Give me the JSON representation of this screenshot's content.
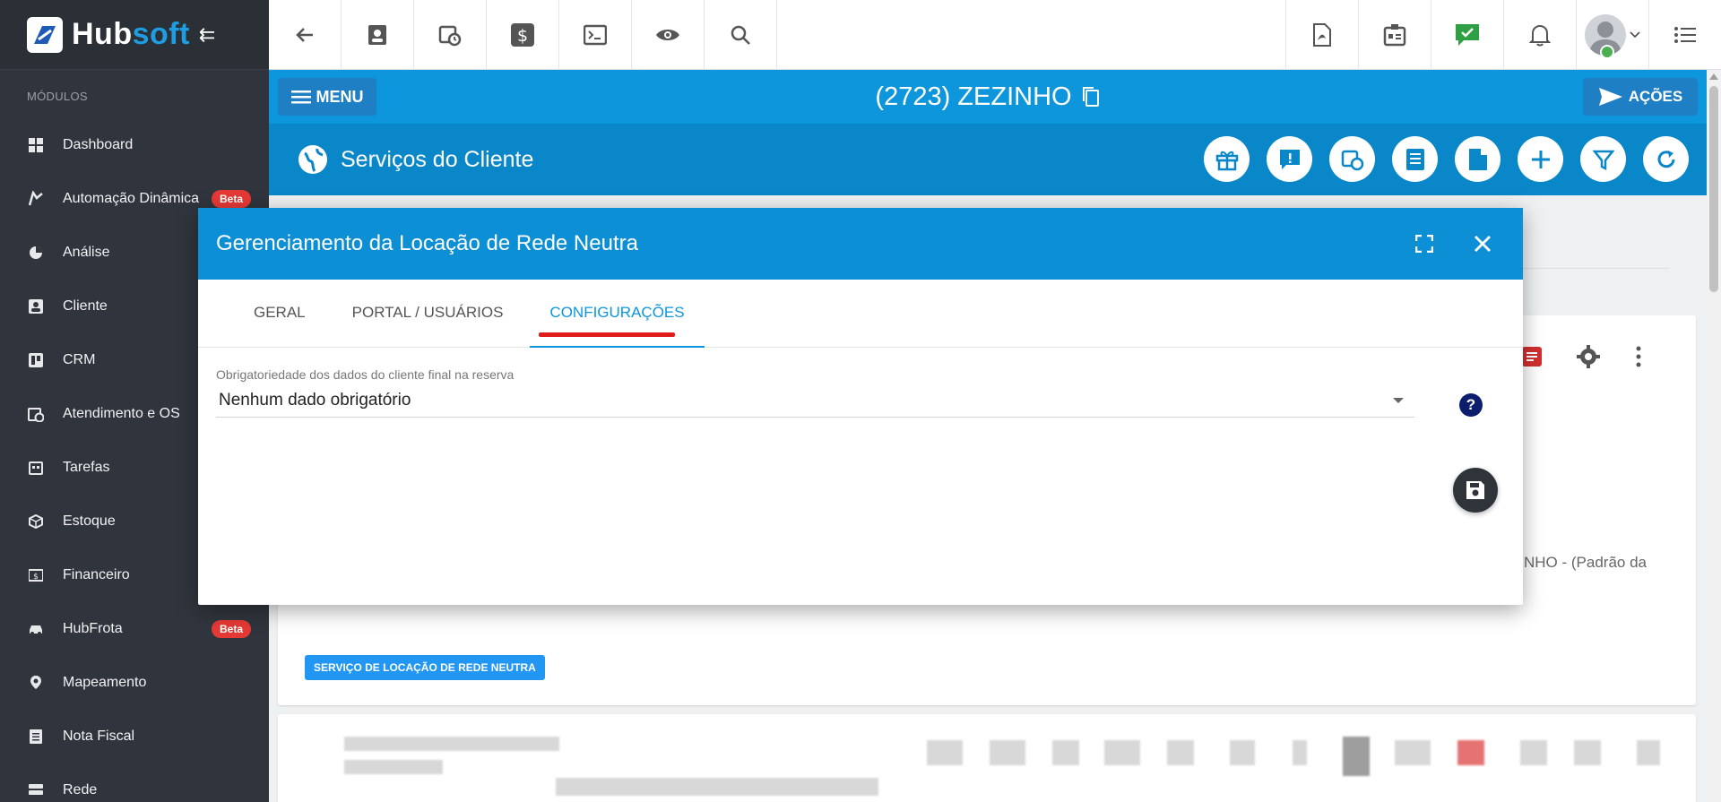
{
  "brand": {
    "hub": "Hub",
    "soft": "soft"
  },
  "sidebar": {
    "section_title": "MÓDULOS",
    "items": [
      {
        "label": "Dashboard",
        "icon": "dashboard-icon"
      },
      {
        "label": "Automação Dinâmica",
        "icon": "automation-icon",
        "badge": "Beta"
      },
      {
        "label": "Análise",
        "icon": "pie-chart-icon"
      },
      {
        "label": "Cliente",
        "icon": "contact-card-icon"
      },
      {
        "label": "CRM",
        "icon": "crm-board-icon"
      },
      {
        "label": "Atendimento e OS",
        "icon": "calendar-clock-icon"
      },
      {
        "label": "Tarefas",
        "icon": "tasks-icon"
      },
      {
        "label": "Estoque",
        "icon": "box-icon"
      },
      {
        "label": "Financeiro",
        "icon": "money-icon"
      },
      {
        "label": "HubFrota",
        "icon": "car-icon",
        "badge": "Beta"
      },
      {
        "label": "Mapeamento",
        "icon": "map-pin-icon"
      },
      {
        "label": "Nota Fiscal",
        "icon": "invoice-icon"
      },
      {
        "label": "Rede",
        "icon": "network-icon"
      }
    ]
  },
  "clientbar": {
    "menu_label": "MENU",
    "client_title": "(2723) ZEZINHO",
    "acoes_label": "AÇÕES"
  },
  "servicebar": {
    "title": "Serviços do Cliente"
  },
  "background": {
    "partial_text": "NHO - (Padrão da",
    "tag": "SERVIÇO DE LOCAÇÃO DE REDE NEUTRA"
  },
  "modal": {
    "title": "Gerenciamento da Locação de Rede Neutra",
    "tabs": [
      "GERAL",
      "PORTAL / USUÁRIOS",
      "CONFIGURAÇÕES"
    ],
    "active_tab": "CONFIGURAÇÕES",
    "field_label": "Obrigatoriedade dos dados do cliente final na reserva",
    "field_value": "Nenhum dado obrigatório",
    "help": "?"
  },
  "colors": {
    "primary": "#0d96db",
    "sidebar": "#30353d",
    "beta": "#e53935",
    "highlight": "#e11b1b"
  }
}
